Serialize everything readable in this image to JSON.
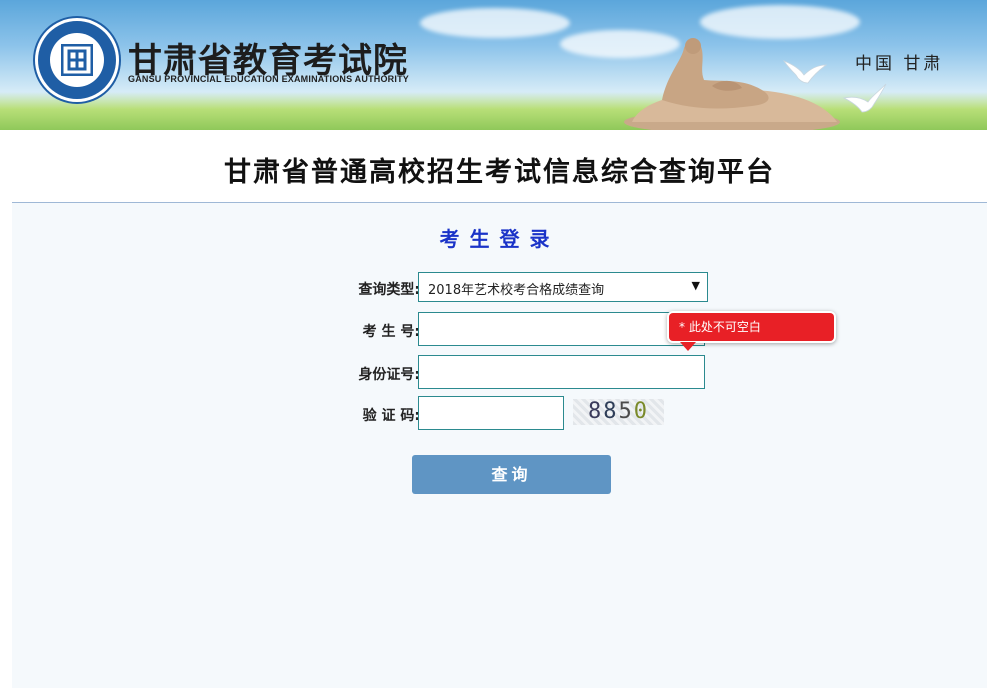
{
  "header": {
    "org_name": "甘肃省教育考试院",
    "org_name_en": "GANSU PROVINCIAL EDUCATION EXAMINATIONS AUTHORITY",
    "region": "中国 甘肃"
  },
  "platform_title": "甘肃省普通高校招生考试信息综合查询平台",
  "login": {
    "heading": "考生登录",
    "query_type_label": "查询类型:",
    "query_type_selected": "2018年艺术校考合格成绩查询",
    "exam_no_label": "考 生 号:",
    "exam_no_value": "",
    "id_label": "身份证号:",
    "id_value": "",
    "captcha_label": "验 证 码:",
    "captcha_value": "",
    "captcha_chars": [
      "8",
      "8",
      "5",
      "0"
    ],
    "error_tip": "* 此处不可空白",
    "submit_label": "查询"
  },
  "colors": {
    "heading_blue": "#1a33c8",
    "button": "#5f95c4",
    "error": "#e82026",
    "field_border": "#2b8a8f"
  }
}
